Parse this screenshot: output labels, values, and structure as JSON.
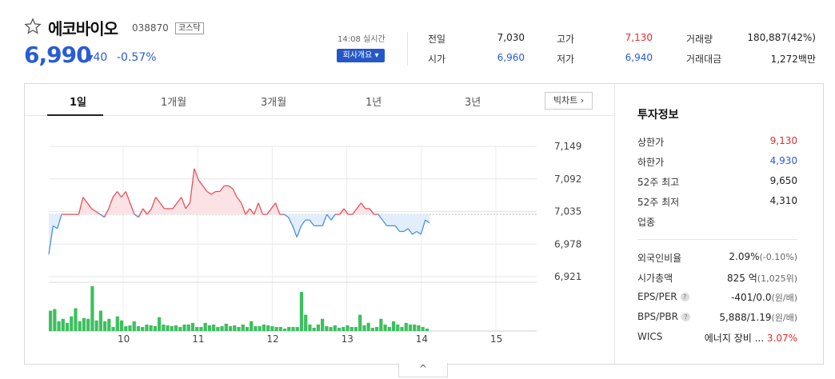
{
  "stock": {
    "name": "에코바이오",
    "code": "038870",
    "market": "코스닥",
    "price": "6,990",
    "change_arrow": "▼",
    "change": "40",
    "change_pct": "-0.57%",
    "realtime": "14:08 실시간",
    "company_button": "회사개요 ▾"
  },
  "summary": {
    "prev_close": {
      "label": "전일",
      "value": "7,030"
    },
    "open": {
      "label": "시가",
      "value": "6,960"
    },
    "high": {
      "label": "고가",
      "value": "7,130"
    },
    "low": {
      "label": "저가",
      "value": "6,940"
    },
    "volume": {
      "label": "거래량",
      "value": "180,887(42%)"
    },
    "amount": {
      "label": "거래대금",
      "value": "1,272백만"
    }
  },
  "tabs": [
    "1일",
    "1개월",
    "3개월",
    "1년",
    "3년"
  ],
  "big_chart_button": "빅차트",
  "chart_data": {
    "type": "line",
    "y_ticks": [
      "7,149",
      "7,092",
      "7,035",
      "6,978",
      "6,921"
    ],
    "ylim": [
      6921,
      7149
    ],
    "reference_price": 7030,
    "x_ticks": [
      "10",
      "11",
      "12",
      "13",
      "14",
      "15"
    ],
    "price": [
      6960,
      7010,
      7005,
      7030,
      7030,
      7030,
      7030,
      7030,
      7060,
      7050,
      7040,
      7035,
      7030,
      7025,
      7040,
      7060,
      7070,
      7060,
      7070,
      7050,
      7030,
      7025,
      7040,
      7030,
      7040,
      7060,
      7050,
      7040,
      7040,
      7040,
      7050,
      7060,
      7040,
      7050,
      7110,
      7090,
      7080,
      7070,
      7065,
      7070,
      7070,
      7080,
      7080,
      7075,
      7060,
      7050,
      7030,
      7040,
      7030,
      7050,
      7030,
      7030,
      7040,
      7050,
      7030,
      7030,
      7025,
      7010,
      6990,
      7010,
      7020,
      7020,
      7010,
      7010,
      7010,
      7030,
      7020,
      7030,
      7030,
      7040,
      7030,
      7030,
      7040,
      7050,
      7040,
      7040,
      7030,
      7030,
      7020,
      7010,
      7010,
      7010,
      7000,
      7000,
      7005,
      6995,
      7000,
      6995,
      7020,
      7015
    ],
    "volume": [
      25,
      27,
      12,
      15,
      10,
      18,
      28,
      12,
      16,
      15,
      55,
      13,
      25,
      12,
      15,
      5,
      18,
      13,
      6,
      7,
      12,
      6,
      5,
      8,
      7,
      6,
      17,
      8,
      7,
      6,
      7,
      5,
      8,
      8,
      10,
      5,
      5,
      10,
      7,
      8,
      5,
      6,
      9,
      6,
      7,
      5,
      8,
      5,
      12,
      6,
      6,
      8,
      7,
      6,
      5,
      5,
      3,
      5,
      5,
      5,
      48,
      20,
      8,
      4,
      8,
      15,
      6,
      5,
      7,
      4,
      5,
      7,
      5,
      5,
      20,
      7,
      10,
      4,
      5,
      15,
      8,
      5,
      12,
      8,
      5,
      10,
      8,
      8,
      7,
      5,
      3
    ],
    "volume_color": "#3dbf5f",
    "up_color": "#e8505b",
    "down_color": "#4a90e2"
  },
  "invest_info": {
    "title": "투자정보",
    "upper_limit": {
      "label": "상한가",
      "value": "9,130"
    },
    "lower_limit": {
      "label": "하한가",
      "value": "4,930"
    },
    "high_52w": {
      "label": "52주 최고",
      "value": "9,650"
    },
    "low_52w": {
      "label": "52주 최저",
      "value": "4,310"
    },
    "sector": {
      "label": "업종",
      "value": ""
    },
    "foreign_ratio": {
      "label": "외국인비율",
      "value": "2.09%",
      "sub": "(-0.10%)"
    },
    "market_cap": {
      "label": "시가총액",
      "value": "825",
      "unit": "억",
      "sub": "(1,025위)"
    },
    "eps_per": {
      "label": "EPS/PER",
      "value": "-401/0.0",
      "sub": "(원/배)"
    },
    "bps_pbr": {
      "label": "BPS/PBR",
      "value": "5,888/1.19",
      "sub": "(원/배)"
    },
    "wics": {
      "label": "WICS",
      "value": "에너지 장비 ...",
      "pct": "3.07%"
    }
  },
  "collapse_icon": "^"
}
